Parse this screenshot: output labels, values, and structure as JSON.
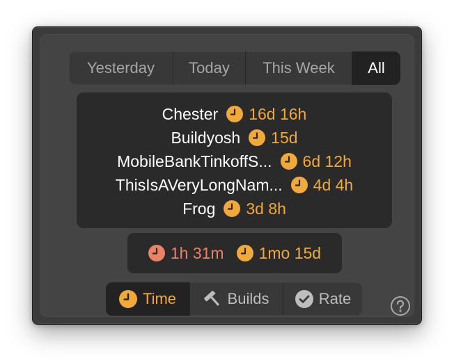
{
  "tabs": {
    "items": [
      "Yesterday",
      "Today",
      "This Week",
      "All"
    ],
    "selected": "All"
  },
  "projects": [
    {
      "name": "Chester",
      "time": "16d 16h"
    },
    {
      "name": "Buildyosh",
      "time": "15d"
    },
    {
      "name": "MobileBankTinkoffS...",
      "time": "6d 12h"
    },
    {
      "name": "ThisIsAVeryLongNam...",
      "time": "4d 4h"
    },
    {
      "name": "Frog",
      "time": "3d 8h"
    }
  ],
  "totals": {
    "first": "1h 31m",
    "second": "1mo 15d"
  },
  "modes": {
    "items": [
      {
        "label": "Time",
        "icon": "clock-icon"
      },
      {
        "label": "Builds",
        "icon": "hammer-icon"
      },
      {
        "label": "Rate",
        "icon": "checkmark-circle-icon"
      }
    ],
    "selected": "Time"
  },
  "help": {
    "icon": "question-mark-icon"
  },
  "colors": {
    "accent_orange": "#f0a93a",
    "accent_salmon": "#ea8266",
    "panel": "#444444",
    "inner_panel": "#2a2a2a",
    "selected_segment": "#222222"
  }
}
